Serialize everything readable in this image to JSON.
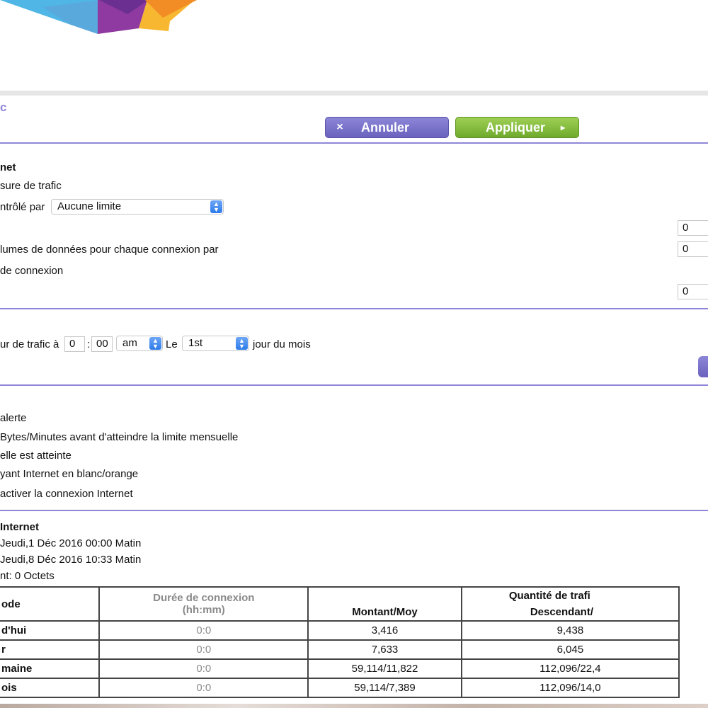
{
  "header": {
    "title_fragment": "c"
  },
  "actions": {
    "cancel_label": "Annuler",
    "apply_label": "Appliquer",
    "cancel_icon": "×",
    "apply_icon": "▸"
  },
  "internet_section": {
    "heading": "net",
    "measure_label": "sure de trafic",
    "controlled_by_label": "ntrôlé par",
    "controlled_by_value": "Aucune limite",
    "volume_label": "lumes de données pour chaque connexion par",
    "connection_label": "de connexion",
    "inputs": [
      "0",
      "0",
      "0"
    ]
  },
  "reset_section": {
    "label_start": "ur de trafic à",
    "hour": "0",
    "separator": ":",
    "minute": "00",
    "ampm": "am",
    "le_label": "Le",
    "day": "1st",
    "day_suffix": "jour du mois"
  },
  "alert_section": {
    "lines": [
      "alerte",
      "Bytes/Minutes avant d'atteindre la limite mensuelle",
      "elle est atteinte",
      "yant Internet en blanc/orange",
      "activer la connexion Internet"
    ]
  },
  "stats_section": {
    "heading": "Internet",
    "start_line": "Jeudi,1 Déc 2016 00:00 Matin",
    "current_line": "Jeudi,8 Déc 2016 10:33 Matin",
    "remaining_line": "nt: 0 Octets"
  },
  "table": {
    "header_period": "ode",
    "header_duration": "Durée de connexion",
    "header_duration_unit": "(hh:mm)",
    "header_quantity": "Quantité de trafi",
    "header_upload": "Montant/Moy",
    "header_download": "Descendant/",
    "rows": [
      {
        "period": "d'hui",
        "duration": "0:0",
        "upload": "3,416",
        "download": "9,438"
      },
      {
        "period": "r",
        "duration": "0:0",
        "upload": "7,633",
        "download": "6,045"
      },
      {
        "period": "maine",
        "duration": "0:0",
        "upload": "59,114/11,822",
        "download": "112,096/22,4"
      },
      {
        "period": "ois",
        "duration": "0:0",
        "upload": "59,114/7,389",
        "download": "112,096/14,0"
      }
    ]
  }
}
